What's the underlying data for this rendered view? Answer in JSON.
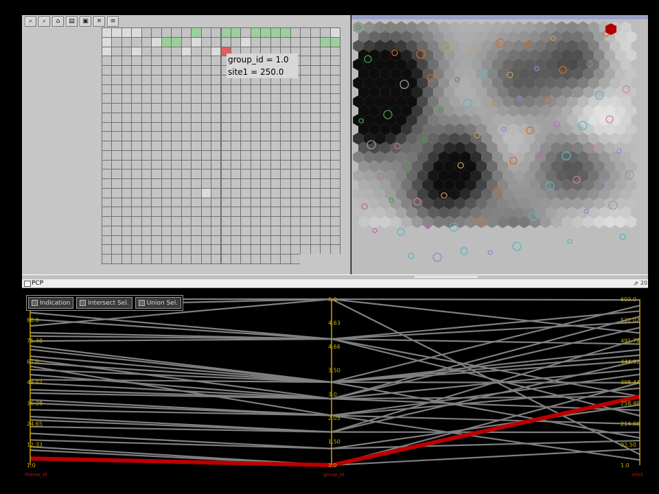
{
  "toolbar": {
    "icons": [
      "zoom-in-icon",
      "zoom-out-icon",
      "home-icon",
      "print-icon",
      "export-icon",
      "select-icon",
      "list-icon"
    ],
    "glyphs": [
      "⌕",
      "⌕",
      "⌂",
      "▤",
      "▣",
      "✕",
      "≡"
    ]
  },
  "grid": {
    "rows": 25,
    "cols": 24,
    "highlight_color": "#9ccf9c",
    "selected_color": "#e06060",
    "light_color": "#dcdcdc"
  },
  "tooltip": {
    "line1": "group_id = 1.0",
    "line2": "site1 = 250.0"
  },
  "pcp": {
    "window_title": "PCP",
    "corner_number": "20",
    "buttons": {
      "indication": "Indication",
      "intersect": "Intersect Sel.",
      "union": "Union Sel."
    },
    "colors": {
      "axis": "#c8a800",
      "label": "#d2b000",
      "axis_name": "#cc1010",
      "line": "#808080",
      "highlight": "#bb0000"
    }
  },
  "chart_data": {
    "type": "parallel-coordinates",
    "axes": [
      {
        "name": "theme_id",
        "ticks": [
          "1.0",
          "12.33",
          "24.65",
          "36.28",
          "48.07",
          "61.0",
          "75.48",
          "86.0",
          "100.0"
        ],
        "range": [
          1,
          100
        ]
      },
      {
        "name": "group_id",
        "ticks": [
          "1.0",
          "1.50",
          "2.05",
          "3.0",
          "3.50",
          "4.66",
          "4.63",
          "6.0"
        ],
        "range": [
          1,
          6
        ]
      },
      {
        "name": "site1",
        "ticks": [
          "1.0",
          "92.50",
          "214.88",
          "258.46",
          "308.44",
          "444.92",
          "491.78",
          "532.02",
          "603.0"
        ],
        "range": [
          1,
          603
        ]
      }
    ],
    "highlighted": [
      5,
      1.0,
      250.0
    ],
    "lines": [
      [
        100,
        6.0,
        600
      ],
      [
        88,
        4.8,
        560
      ],
      [
        75,
        4.8,
        520
      ],
      [
        96,
        6.0,
        480
      ],
      [
        92,
        4.8,
        440
      ],
      [
        70,
        3.5,
        580
      ],
      [
        66,
        3.5,
        420
      ],
      [
        62,
        3.5,
        380
      ],
      [
        58,
        3.5,
        400
      ],
      [
        55,
        3.0,
        350
      ],
      [
        52,
        3.5,
        300
      ],
      [
        50,
        3.0,
        250
      ],
      [
        46,
        3.0,
        500
      ],
      [
        44,
        3.0,
        200
      ],
      [
        40,
        2.5,
        150
      ],
      [
        38,
        2.5,
        330
      ],
      [
        34,
        2.5,
        280
      ],
      [
        30,
        2.0,
        460
      ],
      [
        28,
        2.0,
        120
      ],
      [
        24,
        2.0,
        380
      ],
      [
        20,
        1.5,
        220
      ],
      [
        16,
        1.5,
        90
      ],
      [
        12,
        1.0,
        60
      ],
      [
        10,
        1.0,
        300
      ],
      [
        80,
        4.8,
        250
      ],
      [
        84,
        6.0,
        40
      ],
      [
        78,
        4.8,
        180
      ],
      [
        72,
        3.5,
        100
      ],
      [
        64,
        3.0,
        540
      ],
      [
        60,
        2.5,
        20
      ]
    ]
  }
}
